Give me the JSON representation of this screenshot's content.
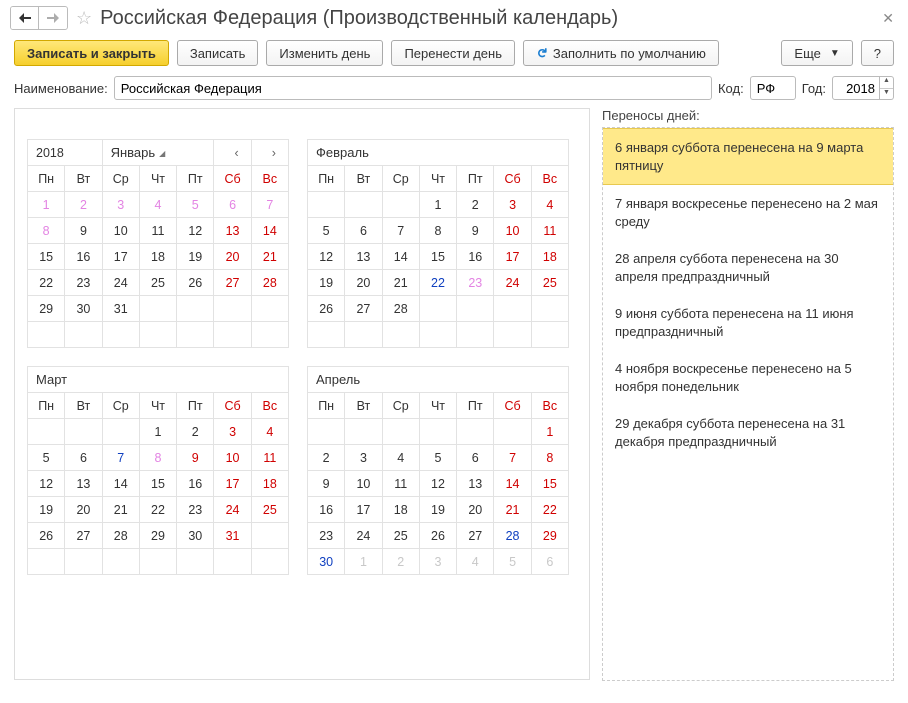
{
  "title": "Российская Федерация (Производственный календарь)",
  "toolbar": {
    "save_close": "Записать и закрыть",
    "save": "Записать",
    "change_day": "Изменить день",
    "move_day": "Перенести день",
    "fill_default": "Заполнить по умолчанию",
    "more": "Еще",
    "help": "?"
  },
  "form": {
    "name_label": "Наименование:",
    "name_value": "Российская Федерация",
    "code_label": "Код:",
    "code_value": "РФ",
    "year_label": "Год:",
    "year_value": "2018"
  },
  "transfers": {
    "title": "Переносы дней:",
    "items": [
      "6 января суббота перенесена на 9 марта пятницу",
      "7 января воскресенье перенесено на 2 мая среду",
      "28 апреля суббота перенесена на 30 апреля предпраздничный",
      "9 июня суббота перенесена на 11 июня предпраздничный",
      "4 ноября воскресенье перенесено на 5 ноября понедельник",
      "29 декабря суббота перенесена на 31 декабря предпраздничный"
    ]
  },
  "dow": [
    "Пн",
    "Вт",
    "Ср",
    "Чт",
    "Пт",
    "Сб",
    "Вс"
  ],
  "year": "2018",
  "months": [
    {
      "name": "Январь",
      "show_year": true,
      "weeks": [
        [
          {
            "d": "1",
            "t": "hol"
          },
          {
            "d": "2",
            "t": "hol"
          },
          {
            "d": "3",
            "t": "hol"
          },
          {
            "d": "4",
            "t": "hol"
          },
          {
            "d": "5",
            "t": "hol"
          },
          {
            "d": "6",
            "t": "hol"
          },
          {
            "d": "7",
            "t": "hol"
          }
        ],
        [
          {
            "d": "8",
            "t": "hol"
          },
          {
            "d": "9",
            "t": "work"
          },
          {
            "d": "10",
            "t": "work"
          },
          {
            "d": "11",
            "t": "work"
          },
          {
            "d": "12",
            "t": "work"
          },
          {
            "d": "13",
            "t": "we"
          },
          {
            "d": "14",
            "t": "we"
          }
        ],
        [
          {
            "d": "15",
            "t": "work"
          },
          {
            "d": "16",
            "t": "work"
          },
          {
            "d": "17",
            "t": "work"
          },
          {
            "d": "18",
            "t": "work"
          },
          {
            "d": "19",
            "t": "work"
          },
          {
            "d": "20",
            "t": "we"
          },
          {
            "d": "21",
            "t": "we"
          }
        ],
        [
          {
            "d": "22",
            "t": "work"
          },
          {
            "d": "23",
            "t": "work"
          },
          {
            "d": "24",
            "t": "work"
          },
          {
            "d": "25",
            "t": "work"
          },
          {
            "d": "26",
            "t": "work"
          },
          {
            "d": "27",
            "t": "we"
          },
          {
            "d": "28",
            "t": "we"
          }
        ],
        [
          {
            "d": "29",
            "t": "work"
          },
          {
            "d": "30",
            "t": "work"
          },
          {
            "d": "31",
            "t": "work"
          },
          {
            "d": "",
            "t": ""
          },
          {
            "d": "",
            "t": ""
          },
          {
            "d": "",
            "t": ""
          },
          {
            "d": "",
            "t": ""
          }
        ],
        [
          {
            "d": "",
            "t": ""
          },
          {
            "d": "",
            "t": ""
          },
          {
            "d": "",
            "t": ""
          },
          {
            "d": "",
            "t": ""
          },
          {
            "d": "",
            "t": ""
          },
          {
            "d": "",
            "t": ""
          },
          {
            "d": "",
            "t": ""
          }
        ]
      ]
    },
    {
      "name": "Февраль",
      "weeks": [
        [
          {
            "d": "",
            "t": ""
          },
          {
            "d": "",
            "t": ""
          },
          {
            "d": "",
            "t": ""
          },
          {
            "d": "1",
            "t": "work"
          },
          {
            "d": "2",
            "t": "work"
          },
          {
            "d": "3",
            "t": "we"
          },
          {
            "d": "4",
            "t": "we"
          }
        ],
        [
          {
            "d": "5",
            "t": "work"
          },
          {
            "d": "6",
            "t": "work"
          },
          {
            "d": "7",
            "t": "work"
          },
          {
            "d": "8",
            "t": "work"
          },
          {
            "d": "9",
            "t": "work"
          },
          {
            "d": "10",
            "t": "we"
          },
          {
            "d": "11",
            "t": "we"
          }
        ],
        [
          {
            "d": "12",
            "t": "work"
          },
          {
            "d": "13",
            "t": "work"
          },
          {
            "d": "14",
            "t": "work"
          },
          {
            "d": "15",
            "t": "work"
          },
          {
            "d": "16",
            "t": "work"
          },
          {
            "d": "17",
            "t": "we"
          },
          {
            "d": "18",
            "t": "we"
          }
        ],
        [
          {
            "d": "19",
            "t": "work"
          },
          {
            "d": "20",
            "t": "work"
          },
          {
            "d": "21",
            "t": "work"
          },
          {
            "d": "22",
            "t": "pre"
          },
          {
            "d": "23",
            "t": "hol"
          },
          {
            "d": "24",
            "t": "we"
          },
          {
            "d": "25",
            "t": "we"
          }
        ],
        [
          {
            "d": "26",
            "t": "work"
          },
          {
            "d": "27",
            "t": "work"
          },
          {
            "d": "28",
            "t": "work"
          },
          {
            "d": "",
            "t": ""
          },
          {
            "d": "",
            "t": ""
          },
          {
            "d": "",
            "t": ""
          },
          {
            "d": "",
            "t": ""
          }
        ],
        [
          {
            "d": "",
            "t": ""
          },
          {
            "d": "",
            "t": ""
          },
          {
            "d": "",
            "t": ""
          },
          {
            "d": "",
            "t": ""
          },
          {
            "d": "",
            "t": ""
          },
          {
            "d": "",
            "t": ""
          },
          {
            "d": "",
            "t": ""
          }
        ]
      ]
    },
    {
      "name": "Март",
      "weeks": [
        [
          {
            "d": "",
            "t": ""
          },
          {
            "d": "",
            "t": ""
          },
          {
            "d": "",
            "t": ""
          },
          {
            "d": "1",
            "t": "work"
          },
          {
            "d": "2",
            "t": "work"
          },
          {
            "d": "3",
            "t": "we"
          },
          {
            "d": "4",
            "t": "we"
          }
        ],
        [
          {
            "d": "5",
            "t": "work"
          },
          {
            "d": "6",
            "t": "work"
          },
          {
            "d": "7",
            "t": "pre"
          },
          {
            "d": "8",
            "t": "hol"
          },
          {
            "d": "9",
            "t": "we"
          },
          {
            "d": "10",
            "t": "we"
          },
          {
            "d": "11",
            "t": "we"
          }
        ],
        [
          {
            "d": "12",
            "t": "work"
          },
          {
            "d": "13",
            "t": "work"
          },
          {
            "d": "14",
            "t": "work"
          },
          {
            "d": "15",
            "t": "work"
          },
          {
            "d": "16",
            "t": "work"
          },
          {
            "d": "17",
            "t": "we"
          },
          {
            "d": "18",
            "t": "we"
          }
        ],
        [
          {
            "d": "19",
            "t": "work"
          },
          {
            "d": "20",
            "t": "work"
          },
          {
            "d": "21",
            "t": "work"
          },
          {
            "d": "22",
            "t": "work"
          },
          {
            "d": "23",
            "t": "work"
          },
          {
            "d": "24",
            "t": "we"
          },
          {
            "d": "25",
            "t": "we"
          }
        ],
        [
          {
            "d": "26",
            "t": "work"
          },
          {
            "d": "27",
            "t": "work"
          },
          {
            "d": "28",
            "t": "work"
          },
          {
            "d": "29",
            "t": "work"
          },
          {
            "d": "30",
            "t": "work"
          },
          {
            "d": "31",
            "t": "we"
          },
          {
            "d": "",
            "t": ""
          }
        ],
        [
          {
            "d": "",
            "t": ""
          },
          {
            "d": "",
            "t": ""
          },
          {
            "d": "",
            "t": ""
          },
          {
            "d": "",
            "t": ""
          },
          {
            "d": "",
            "t": ""
          },
          {
            "d": "",
            "t": ""
          },
          {
            "d": "",
            "t": ""
          }
        ]
      ]
    },
    {
      "name": "Апрель",
      "weeks": [
        [
          {
            "d": "",
            "t": ""
          },
          {
            "d": "",
            "t": ""
          },
          {
            "d": "",
            "t": ""
          },
          {
            "d": "",
            "t": ""
          },
          {
            "d": "",
            "t": ""
          },
          {
            "d": "",
            "t": ""
          },
          {
            "d": "1",
            "t": "we"
          }
        ],
        [
          {
            "d": "2",
            "t": "work"
          },
          {
            "d": "3",
            "t": "work"
          },
          {
            "d": "4",
            "t": "work"
          },
          {
            "d": "5",
            "t": "work"
          },
          {
            "d": "6",
            "t": "work"
          },
          {
            "d": "7",
            "t": "we"
          },
          {
            "d": "8",
            "t": "we"
          }
        ],
        [
          {
            "d": "9",
            "t": "work"
          },
          {
            "d": "10",
            "t": "work"
          },
          {
            "d": "11",
            "t": "work"
          },
          {
            "d": "12",
            "t": "work"
          },
          {
            "d": "13",
            "t": "work"
          },
          {
            "d": "14",
            "t": "we"
          },
          {
            "d": "15",
            "t": "we"
          }
        ],
        [
          {
            "d": "16",
            "t": "work"
          },
          {
            "d": "17",
            "t": "work"
          },
          {
            "d": "18",
            "t": "work"
          },
          {
            "d": "19",
            "t": "work"
          },
          {
            "d": "20",
            "t": "work"
          },
          {
            "d": "21",
            "t": "we"
          },
          {
            "d": "22",
            "t": "we"
          }
        ],
        [
          {
            "d": "23",
            "t": "work"
          },
          {
            "d": "24",
            "t": "work"
          },
          {
            "d": "25",
            "t": "work"
          },
          {
            "d": "26",
            "t": "work"
          },
          {
            "d": "27",
            "t": "work"
          },
          {
            "d": "28",
            "t": "pre"
          },
          {
            "d": "29",
            "t": "we"
          }
        ],
        [
          {
            "d": "30",
            "t": "pre"
          },
          {
            "d": "1",
            "t": "mute"
          },
          {
            "d": "2",
            "t": "mute"
          },
          {
            "d": "3",
            "t": "mute"
          },
          {
            "d": "4",
            "t": "mute"
          },
          {
            "d": "5",
            "t": "mute"
          },
          {
            "d": "6",
            "t": "mute"
          }
        ]
      ]
    }
  ]
}
